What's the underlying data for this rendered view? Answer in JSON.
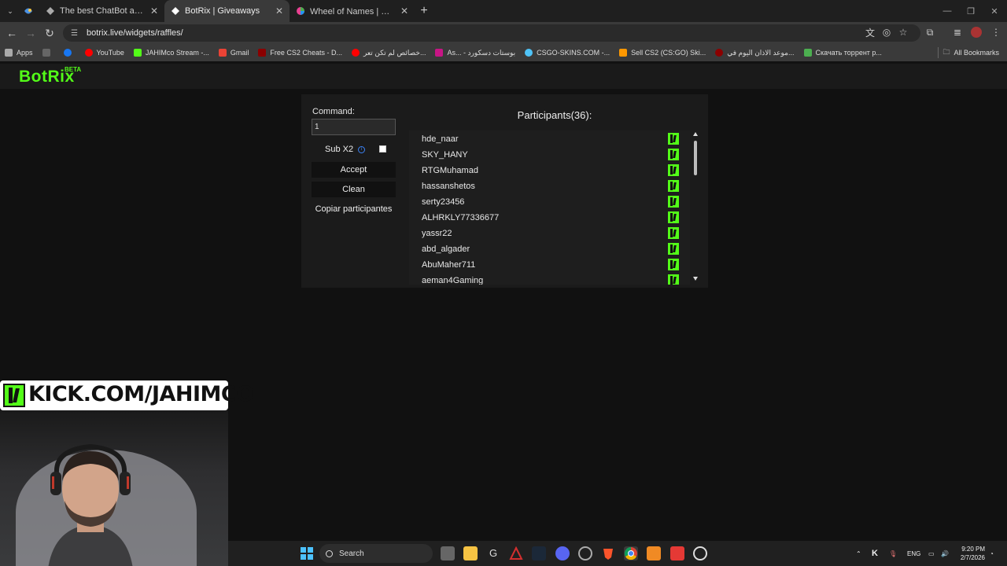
{
  "browser": {
    "tabs": [
      {
        "label": "The best ChatBot and Widgets",
        "favicon_color": "#53fc18",
        "active": false
      },
      {
        "label": "BotRix | Giveaways",
        "favicon_color": "#ffffff",
        "active": true
      },
      {
        "label": "Wheel of Names | عجلة الأسماء العشوائي",
        "favicon_color": "#e84393",
        "active": false
      }
    ],
    "url": "botrix.live/widgets/raffles/",
    "bookmarks": [
      {
        "label": "Apps",
        "color": "#aaaaaa"
      },
      {
        "label": "",
        "color": "#1877f2"
      },
      {
        "label": "YouTube",
        "color": "#ff0000"
      },
      {
        "label": "JAHIMco Stream -...",
        "color": "#53fc18"
      },
      {
        "label": "Gmail",
        "color": "#ea4335"
      },
      {
        "label": "Free CS2 Cheats - D...",
        "color": "#8b0000"
      },
      {
        "label": "خصائص لم تكن تعر...",
        "color": "#ff0000"
      },
      {
        "label": "As... - بوستات دسكورد",
        "color": "#c71585"
      },
      {
        "label": "CSGO-SKINS.COM -...",
        "color": "#4fc3f7"
      },
      {
        "label": "Sell CS2 (CS:GO) Ski...",
        "color": "#ff9800"
      },
      {
        "label": "موعد الاذان اليوم في...",
        "color": "#8b0000"
      },
      {
        "label": "Скачать торрент р...",
        "color": "#4caf50"
      }
    ],
    "all_bookmarks": "All Bookmarks"
  },
  "app": {
    "logo": "BotRix",
    "logo_badge": "BETA",
    "accent": "#53fc18"
  },
  "widget": {
    "command_label": "Command:",
    "command_value": "1",
    "subx2_label": "Sub X2",
    "subx2_checked": false,
    "accept_label": "Accept",
    "clean_label": "Clean",
    "copy_label": "Copiar participantes",
    "participants_title": "Participants(36):",
    "participants": [
      "hde_naar",
      "SKY_HANY",
      "RTGMuhamad",
      "hassanshetos",
      "serty23456",
      "ALHRKLY77336677",
      "yassr22",
      "abd_algader",
      "AbuMaher711",
      "aeman4Gaming"
    ]
  },
  "overlay": {
    "banner_text": "KICK.COM/JAHIMCO"
  },
  "taskbar": {
    "search_label": "Search",
    "lang": "ENG",
    "time": "9:20 PM",
    "date": "2/7/2026"
  }
}
